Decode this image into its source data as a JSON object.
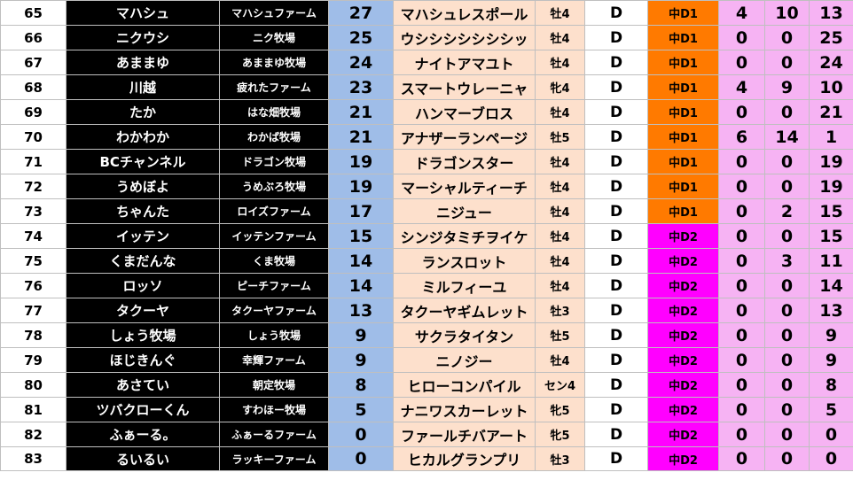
{
  "rows": [
    {
      "rank": "65",
      "owner": "マハシュ",
      "farm": "マハシュファーム",
      "pts": "27",
      "horse": "マハシュレスポール",
      "age": "牡4",
      "grade": "D",
      "cls": "中D1",
      "w": "4",
      "p": "10",
      "l": "13"
    },
    {
      "rank": "66",
      "owner": "ニクウシ",
      "farm": "ニク牧場",
      "pts": "25",
      "horse": "ウシシシシシシシッ",
      "age": "牡4",
      "grade": "D",
      "cls": "中D1",
      "w": "0",
      "p": "0",
      "l": "25"
    },
    {
      "rank": "67",
      "owner": "あままゆ",
      "farm": "あままゆ牧場",
      "pts": "24",
      "horse": "ナイトアマユト",
      "age": "牡4",
      "grade": "D",
      "cls": "中D1",
      "w": "0",
      "p": "0",
      "l": "24"
    },
    {
      "rank": "68",
      "owner": "川越",
      "farm": "疲れたファーム",
      "pts": "23",
      "horse": "スマートウレーニャ",
      "age": "牝4",
      "grade": "D",
      "cls": "中D1",
      "w": "4",
      "p": "9",
      "l": "10"
    },
    {
      "rank": "69",
      "owner": "たか",
      "farm": "はな畑牧場",
      "pts": "21",
      "horse": "ハンマーブロス",
      "age": "牡4",
      "grade": "D",
      "cls": "中D1",
      "w": "0",
      "p": "0",
      "l": "21"
    },
    {
      "rank": "70",
      "owner": "わかわか",
      "farm": "わかば牧場",
      "pts": "21",
      "horse": "アナザーランページ",
      "age": "牡5",
      "grade": "D",
      "cls": "中D1",
      "w": "6",
      "p": "14",
      "l": "1"
    },
    {
      "rank": "71",
      "owner": "BCチャンネル",
      "farm": "ドラゴン牧場",
      "pts": "19",
      "horse": "ドラゴンスター",
      "age": "牡4",
      "grade": "D",
      "cls": "中D1",
      "w": "0",
      "p": "0",
      "l": "19"
    },
    {
      "rank": "72",
      "owner": "うめぼよ",
      "farm": "うめぶろ牧場",
      "pts": "19",
      "horse": "マーシャルティーチ",
      "age": "牡4",
      "grade": "D",
      "cls": "中D1",
      "w": "0",
      "p": "0",
      "l": "19"
    },
    {
      "rank": "73",
      "owner": "ちゃんた",
      "farm": "ロイズファーム",
      "pts": "17",
      "horse": "ニジュー",
      "age": "牡4",
      "grade": "D",
      "cls": "中D1",
      "w": "0",
      "p": "2",
      "l": "15"
    },
    {
      "rank": "74",
      "owner": "イッテン",
      "farm": "イッテンファーム",
      "pts": "15",
      "horse": "シンジタミチヲイケ",
      "age": "牡4",
      "grade": "D",
      "cls": "中D2",
      "w": "0",
      "p": "0",
      "l": "15"
    },
    {
      "rank": "75",
      "owner": "くまだんな",
      "farm": "くま牧場",
      "pts": "14",
      "horse": "ランスロット",
      "age": "牡4",
      "grade": "D",
      "cls": "中D2",
      "w": "0",
      "p": "3",
      "l": "11"
    },
    {
      "rank": "76",
      "owner": "ロッソ",
      "farm": "ピーチファーム",
      "pts": "14",
      "horse": "ミルフィーユ",
      "age": "牡4",
      "grade": "D",
      "cls": "中D2",
      "w": "0",
      "p": "0",
      "l": "14"
    },
    {
      "rank": "77",
      "owner": "タクーヤ",
      "farm": "タクーヤファーム",
      "pts": "13",
      "horse": "タクーヤギムレット",
      "age": "牡3",
      "grade": "D",
      "cls": "中D2",
      "w": "0",
      "p": "0",
      "l": "13"
    },
    {
      "rank": "78",
      "owner": "しょう牧場",
      "farm": "しょう牧場",
      "pts": "9",
      "horse": "サクラタイタン",
      "age": "牡5",
      "grade": "D",
      "cls": "中D2",
      "w": "0",
      "p": "0",
      "l": "9"
    },
    {
      "rank": "79",
      "owner": "ほじきんぐ",
      "farm": "幸輝ファーム",
      "pts": "9",
      "horse": "ニノジー",
      "age": "牡4",
      "grade": "D",
      "cls": "中D2",
      "w": "0",
      "p": "0",
      "l": "9"
    },
    {
      "rank": "80",
      "owner": "あさてい",
      "farm": "朝定牧場",
      "pts": "8",
      "horse": "ヒローコンパイル",
      "age": "セン4",
      "grade": "D",
      "cls": "中D2",
      "w": "0",
      "p": "0",
      "l": "8"
    },
    {
      "rank": "81",
      "owner": "ツバクローくん",
      "farm": "すわほー牧場",
      "pts": "5",
      "horse": "ナニワスカーレット",
      "age": "牝5",
      "grade": "D",
      "cls": "中D2",
      "w": "0",
      "p": "0",
      "l": "5"
    },
    {
      "rank": "82",
      "owner": "ふぁーる。",
      "farm": "ふぁーるファーム",
      "pts": "0",
      "horse": "ファールチバアート",
      "age": "牝5",
      "grade": "D",
      "cls": "中D2",
      "w": "0",
      "p": "0",
      "l": "0"
    },
    {
      "rank": "83",
      "owner": "るいるい",
      "farm": "ラッキーファーム",
      "pts": "0",
      "horse": "ヒカルグランプリ",
      "age": "牡3",
      "grade": "D",
      "cls": "中D2",
      "w": "0",
      "p": "0",
      "l": "0"
    }
  ],
  "colors": {
    "owner_bg": "#000000",
    "points_bg": "#9fbde8",
    "horse_bg": "#fde0cc",
    "class_d1": "#ff7a00",
    "class_d2": "#ff00ff",
    "stats_bg": "#f6b3f3"
  }
}
